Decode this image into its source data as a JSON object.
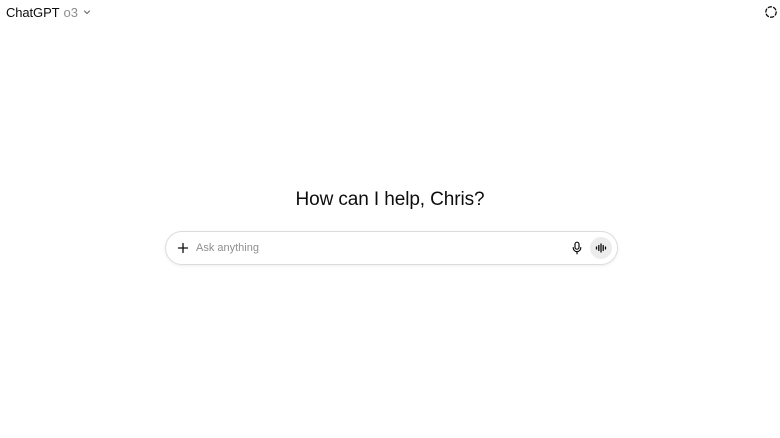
{
  "header": {
    "app_name": "ChatGPT",
    "model": "o3",
    "model_chevron_icon": "chevron-down-icon",
    "temporary_chat_icon": "dashed-circle-icon"
  },
  "main": {
    "greeting": "How can I help, Chris?"
  },
  "composer": {
    "placeholder": "Ask anything",
    "value": "",
    "attach_icon": "plus-icon",
    "dictate_icon": "microphone-icon",
    "voice_mode_icon": "voice-waveform-icon"
  },
  "colors": {
    "text_primary": "#0d0d0d",
    "text_secondary": "#8f8f8f",
    "composer_border": "#dcdcdc",
    "voice_button_bg": "#ececec",
    "background": "#ffffff"
  }
}
